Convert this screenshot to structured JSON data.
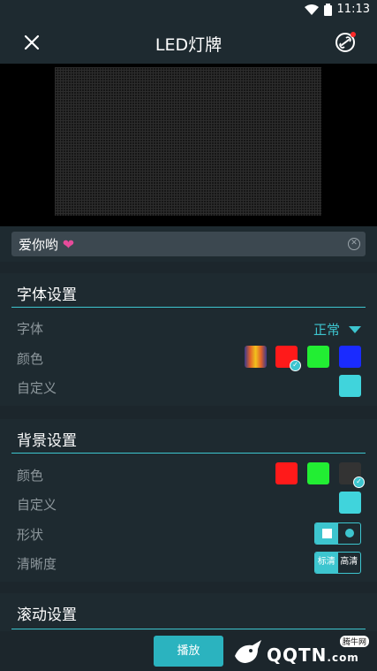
{
  "status": {
    "time": "11:13"
  },
  "header": {
    "title": "LED灯牌"
  },
  "input": {
    "text": "爱你哟",
    "emoji": "❤"
  },
  "font_settings": {
    "title": "字体设置",
    "font_label": "字体",
    "font_value": "正常",
    "color_label": "颜色",
    "custom_label": "自定义",
    "colors": [
      "gradient",
      "#ff1a1a",
      "#22ee33",
      "#1a2bff"
    ],
    "selected_color": "#ff1a1a",
    "custom_color": "#40d4dc"
  },
  "background_settings": {
    "title": "背景设置",
    "color_label": "颜色",
    "custom_label": "自定义",
    "shape_label": "形状",
    "clarity_label": "清晰度",
    "colors": [
      "#ff1a1a",
      "#22ee33",
      "#333333"
    ],
    "selected_color": "#333333",
    "custom_color": "#40d4dc",
    "shape_options": [
      "square",
      "circle"
    ],
    "shape_selected": "square",
    "clarity_options": [
      "标清",
      "高清"
    ],
    "clarity_selected": "标清"
  },
  "scroll_settings": {
    "title": "滚动设置"
  },
  "actions": {
    "play_label": "播放"
  },
  "watermark": {
    "brand": "QQTN",
    "domain": ".com",
    "tag": "腾牛网"
  },
  "accent_color": "#3dc5cf"
}
